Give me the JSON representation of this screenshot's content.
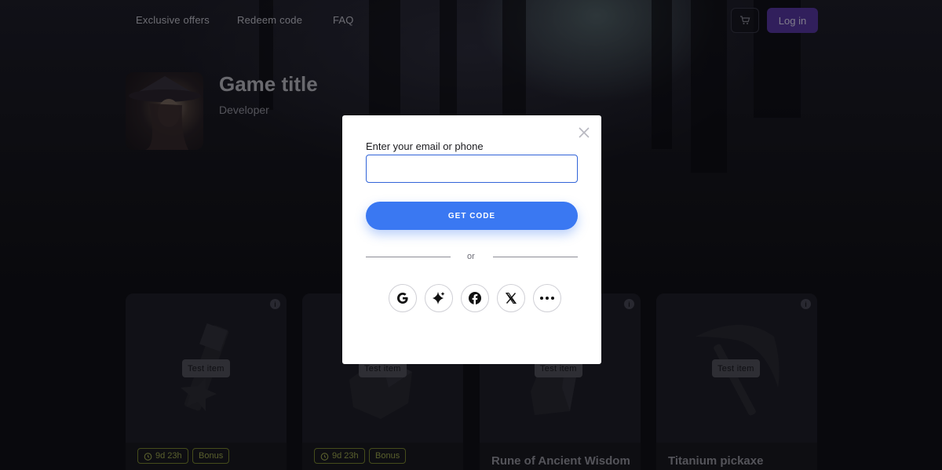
{
  "nav": {
    "links": [
      "Exclusive offers",
      "Redeem code",
      "FAQ"
    ],
    "login_label": "Log in"
  },
  "game": {
    "title": "Game title",
    "developer": "Developer"
  },
  "cards": [
    {
      "tag": "Test item",
      "timer": "9d 23h",
      "bonus": "Bonus",
      "name": ""
    },
    {
      "tag": "Test item",
      "timer": "9d 23h",
      "bonus": "Bonus",
      "name": ""
    },
    {
      "tag": "Test item",
      "timer": "",
      "bonus": "",
      "name": "Rune of Ancient Wisdom"
    },
    {
      "tag": "Test item",
      "timer": "",
      "bonus": "",
      "name": "Titanium pickaxe"
    }
  ],
  "modal": {
    "field_label": "Enter your email or phone",
    "field_value": "",
    "get_code_label": "GET CODE",
    "divider_text": "or",
    "social_icons": [
      "google-icon",
      "sparkle-icon",
      "facebook-icon",
      "x-icon",
      "more-icon"
    ]
  },
  "colors": {
    "primary_button": "#3a78f2",
    "login_button": "#5a3aa8",
    "input_border": "#3164d8",
    "pill_accent": "#a3ae52"
  }
}
